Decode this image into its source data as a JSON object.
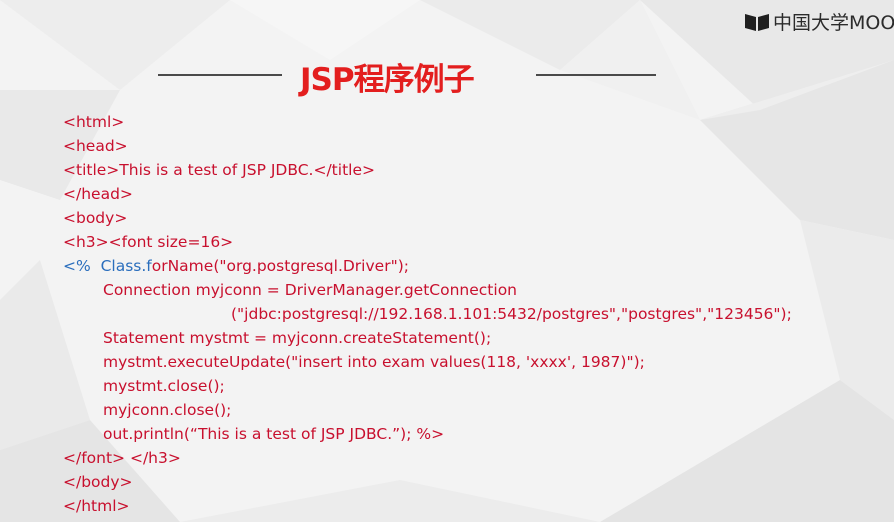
{
  "watermark": {
    "text": "中国大学MOOC",
    "icon": "mooc-book-icon"
  },
  "slide": {
    "title": "JSP程序例子"
  },
  "code": {
    "l1": "<html>",
    "l2": "<head>",
    "l3": "<title>This is a test of JSP JDBC.</title>",
    "l4": "</head>",
    "l5": "<body>",
    "l6": "<h3><font size=16>",
    "l7_blue": "<%  Class.f",
    "l7_rest": "orName(\"org.postgresql.Driver\");",
    "l8": "Connection myjconn = DriverManager.getConnection",
    "l9": "(\"jdbc:postgresql://192.168.1.101:5432/postgres\",\"postgres\",\"123456\");",
    "l10": "Statement mystmt = myjconn.createStatement();",
    "l11": "mystmt.executeUpdate(\"insert into exam values(118, 'xxxx', 1987)\");",
    "l12": "mystmt.close();",
    "l13": "myjconn.close();",
    "l14": "out.println(“This is a test of JSP JDBC.”); %>",
    "l15": "</font> </h3>",
    "l16": "</body>",
    "l17": "</html>"
  },
  "colors": {
    "code_text": "#c8102e",
    "code_keyword": "#2a6ebd",
    "title": "#e31e1e",
    "background": "#f2f2f2"
  }
}
